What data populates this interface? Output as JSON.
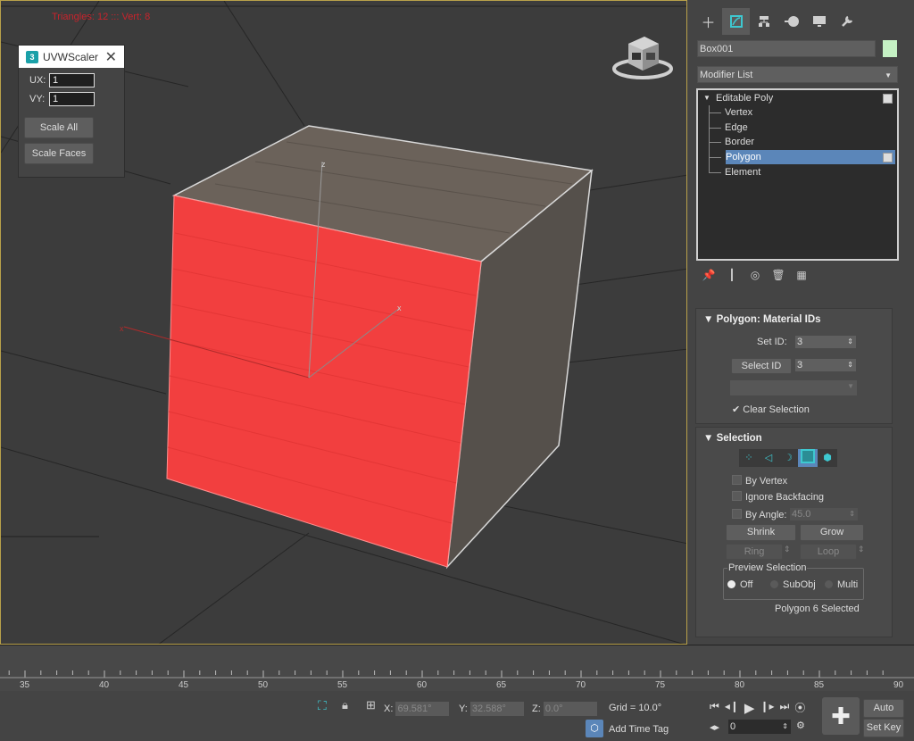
{
  "viewport": {
    "stats": "Triangles: 12 ::: Vert: 8",
    "axis_x_label": "x",
    "axis_z_label": "z"
  },
  "uvw_scaler": {
    "title": "UVWScaler",
    "ux_label": "UX:",
    "ux_value": "1",
    "vy_label": "VY:",
    "vy_value": "1",
    "scale_all_label": "Scale All",
    "scale_faces_label": "Scale Faces"
  },
  "command_panel": {
    "object_name": "Box001",
    "object_color": "#c5f1c4",
    "modifier_list_label": "Modifier List",
    "stack": {
      "root": "Editable Poly",
      "items": [
        "Vertex",
        "Edge",
        "Border",
        "Polygon",
        "Element"
      ],
      "selected": "Polygon"
    },
    "material_ids": {
      "title": "Polygon: Material IDs",
      "set_id_label": "Set ID:",
      "set_id_value": "3",
      "select_id_label": "Select ID",
      "select_id_value": "3",
      "clear_selection_label": "Clear Selection"
    },
    "selection": {
      "title": "Selection",
      "by_vertex_label": "By Vertex",
      "ignore_backfacing_label": "Ignore Backfacing",
      "by_angle_label": "By Angle:",
      "by_angle_value": "45.0",
      "shrink_label": "Shrink",
      "grow_label": "Grow",
      "ring_label": "Ring",
      "loop_label": "Loop",
      "preview_selection_label": "Preview Selection",
      "preview_off": "Off",
      "preview_subobj": "SubObj",
      "preview_multi": "Multi",
      "status": "Polygon 6 Selected"
    }
  },
  "timeline": {
    "ticks": [
      "35",
      "40",
      "45",
      "50",
      "55",
      "60",
      "65",
      "70",
      "75",
      "80",
      "85",
      "90"
    ]
  },
  "status_bar": {
    "x_label": "X:",
    "x_value": "69.581°",
    "y_label": "Y:",
    "y_value": "32.588°",
    "z_label": "Z:",
    "z_value": "0.0°",
    "grid": "Grid = 10.0°",
    "add_time_tag": "Add Time Tag",
    "frame_value": "0",
    "auto_key": "Auto Key",
    "set_key": "Set Key"
  }
}
